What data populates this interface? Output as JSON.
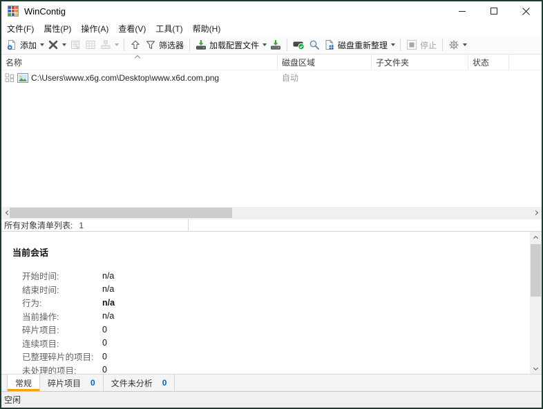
{
  "window": {
    "title": "WinContig"
  },
  "menu": {
    "items": [
      "文件(F)",
      "属性(P)",
      "操作(A)",
      "查看(V)",
      "工具(T)",
      "帮助(H)"
    ]
  },
  "toolbar": {
    "add_label": "添加",
    "filter_label": "筛选器",
    "load_profile_label": "加载配置文件",
    "defrag_label": "磁盘重新整理",
    "stop_label": "停止"
  },
  "table": {
    "columns": [
      "名称",
      "磁盘区域",
      "子文件夹",
      "状态"
    ],
    "sort": {
      "column": "名称",
      "direction": "asc"
    },
    "rows": [
      {
        "name": "C:\\Users\\www.x6g.com\\Desktop\\www.x6d.com.png",
        "disk_area": "自动",
        "subfolder": "",
        "status": ""
      }
    ]
  },
  "list_summary": {
    "label": "所有对象清单列表:",
    "count": "1"
  },
  "session": {
    "title": "当前会话",
    "fields": [
      {
        "label": "开始时间:",
        "value": "n/a"
      },
      {
        "label": "结束时间:",
        "value": "n/a"
      },
      {
        "label": "行为:",
        "value": "n/a"
      },
      {
        "label": "当前操作:",
        "value": "n/a"
      },
      {
        "label": "碎片项目:",
        "value": "0"
      },
      {
        "label": "连续项目:",
        "value": "0"
      },
      {
        "label": "已整理碎片的项目:",
        "value": "0"
      },
      {
        "label": "未处理的项目:",
        "value": "0"
      }
    ]
  },
  "tabs": [
    {
      "label": "常规",
      "count": null,
      "active": true
    },
    {
      "label": "碎片项目",
      "count": "0",
      "active": false
    },
    {
      "label": "文件未分析",
      "count": "0",
      "active": false
    }
  ],
  "statusbar": {
    "text": "空闲"
  },
  "icons": {
    "app-logo": "colored-grid",
    "add-file": "page-with-plus",
    "remove": "x-cross",
    "properties": "page-lines-disabled",
    "grid-view": "grid-disabled",
    "drive-tools": "drive-stamp-disabled",
    "move-up": "arrow-up-outline",
    "filter": "funnel",
    "load-profile": "drive-green-down-arrow",
    "save-profile": "drive-green-down-arrow",
    "analyze": "drive-green-check",
    "search": "magnifier",
    "defragment": "page-blue-squares",
    "stop": "gray-square",
    "settings": "gear",
    "row-fragment": "four-squares-outline",
    "row-file-type": "image-thumbnail"
  },
  "colors": {
    "window_border": "#1d3b32",
    "accent_blue": "#0066cc",
    "tab_active_underline": "#f0a30a",
    "muted_text": "#9b9b9b",
    "disabled_text": "#a6a6a6",
    "green_icon": "#3fa435"
  }
}
